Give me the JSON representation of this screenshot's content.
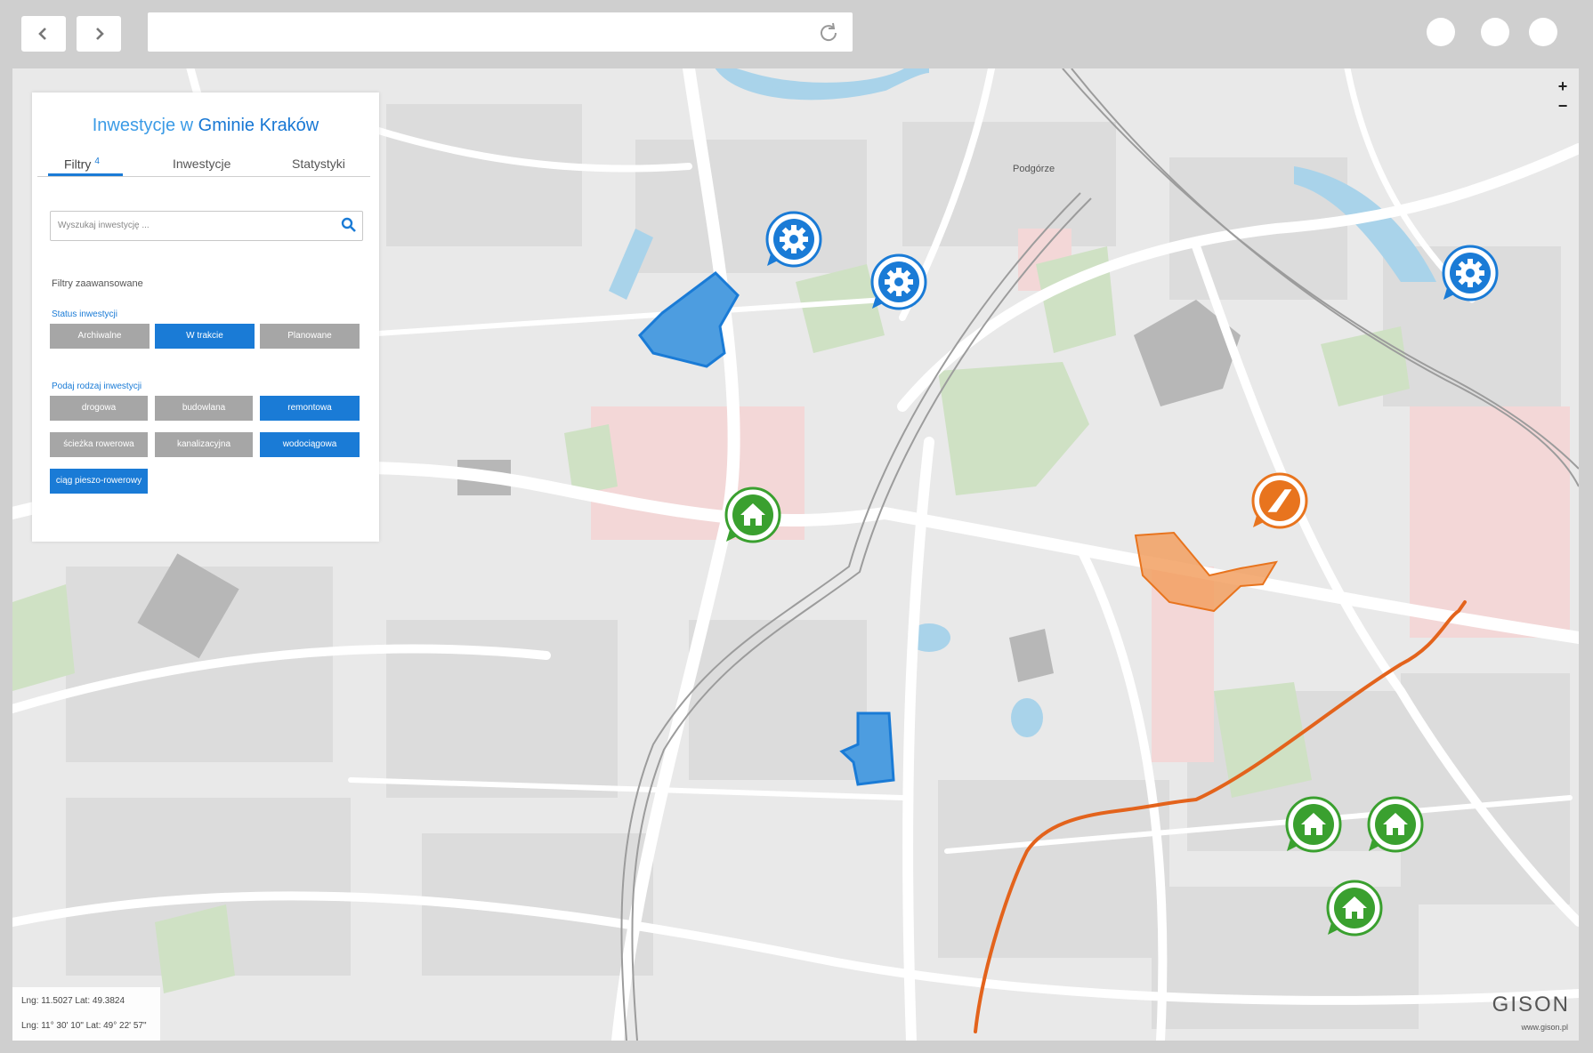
{
  "panel": {
    "title_prefix": "Inwestycje w ",
    "title_highlight": "Gminie Kraków",
    "tabs": [
      {
        "label": "Filtry",
        "badge": "4"
      },
      {
        "label": "Inwestycje"
      },
      {
        "label": "Statystyki"
      }
    ],
    "search_placeholder": "Wyszukaj inwestycję ...",
    "advanced_label": "Filtry zaawansowane",
    "status_title": "Status inwestycji",
    "status_buttons": [
      {
        "label": "Archiwalne",
        "active": false
      },
      {
        "label": "W trakcie",
        "active": true
      },
      {
        "label": "Planowane",
        "active": false
      }
    ],
    "type_title": "Podaj rodzaj inwestycji",
    "type_buttons": [
      {
        "label": "drogowa",
        "active": false
      },
      {
        "label": "budowlana",
        "active": false
      },
      {
        "label": "remontowa",
        "active": true
      },
      {
        "label": "ścieżka rowerowa",
        "active": false
      },
      {
        "label": "kanalizacyjna",
        "active": false
      },
      {
        "label": "wodociągowa",
        "active": true
      },
      {
        "label": "ciąg pieszo-rowerowy",
        "active": true
      }
    ]
  },
  "map": {
    "place_label": "Podgórze",
    "zoom_in": "+",
    "zoom_out": "−",
    "coords": {
      "decimal": "Lng: 11.5027 Lat: 49.3824",
      "dms": "Lng: 11° 30' 10\" Lat: 49° 22' 57\""
    },
    "brand": "GISON",
    "brand_url": "www.gison.pl",
    "colors": {
      "blue": "#1a7bd6",
      "green": "#3aa02f",
      "orange": "#e8741e",
      "line": "#e3631c"
    }
  }
}
